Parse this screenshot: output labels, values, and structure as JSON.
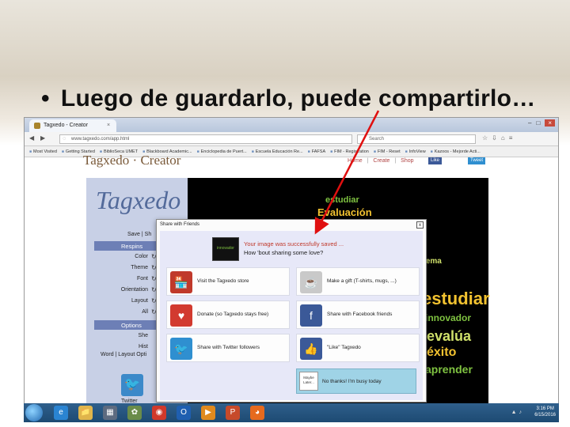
{
  "slide": {
    "bullet": "•",
    "title": "Luego de guardarlo, puede compartirlo…"
  },
  "browser": {
    "tab_title": "Tagxedo - Creator",
    "tab_close": "×",
    "window_controls": [
      "–",
      "□",
      "×"
    ],
    "back": "◀",
    "forward": "▶",
    "url": "www.tagxedo.com/app.html",
    "search_placeholder": "Search",
    "bookmarks": [
      "Most Visited",
      "Getting Started",
      "BiblioSeca UMET",
      "Blackboard Academic...",
      "Enciclopedia de Puert...",
      "Escuela Educación Re...",
      "FAFSA",
      "FIM - Registration",
      "FIM - Reset",
      "InfoView",
      "Kazoos - Mejorde Acti..."
    ]
  },
  "site": {
    "logo": "Tagxedo · Creator",
    "nav": [
      "Home",
      "Create",
      "Shop"
    ],
    "social": [
      {
        "label": "Like",
        "color": "#3b5998"
      },
      {
        "label": "Tweet",
        "color": "#2f8fd0"
      }
    ],
    "panel_logo": "Tagxedo",
    "save_row": "Save | Sh",
    "respins_header": "Respins",
    "respin_items": [
      "Color",
      "Theme",
      "Font",
      "Orientation",
      "Layout",
      "All"
    ],
    "options_header": "Options",
    "option_items": [
      "She",
      "Hist"
    ],
    "word_options": "Word | Layout Opti",
    "twitter_label": "Twitter"
  },
  "word_cloud": {
    "words": [
      "estudiar",
      "Evaluación",
      "innovador",
      "lema",
      "estudiar",
      "innovador",
      "evalúa",
      "éxito",
      "aprender"
    ],
    "colors": [
      "#7fc241",
      "#f2c230",
      "#7fc241",
      "#cfe06a",
      "#f2c230",
      "#7fc241",
      "#cfe06a",
      "#f2c230",
      "#7fc241"
    ]
  },
  "dialog": {
    "title": "Share with Friends",
    "close": "x",
    "thumb_text": "innovador",
    "saved_message": "Your image was successfully saved ...",
    "ask_message": "How 'bout sharing some love?",
    "options": [
      {
        "label": "Visit the Tagxedo store",
        "icon": "store-icon",
        "glyph": "🏪",
        "color": "#c0392b"
      },
      {
        "label": "Make a gift (T-shirts, mugs, ...)",
        "icon": "mug-icon",
        "glyph": "☕",
        "color": "#c9c9c9"
      },
      {
        "label": "Donate (so Tagxedo stays free)",
        "icon": "heart-icon",
        "glyph": "♥",
        "color": "#d23a2f"
      },
      {
        "label": "Share with Facebook friends",
        "icon": "facebook-icon",
        "glyph": "f",
        "color": "#3b5998"
      },
      {
        "label": "Share with Twitter followers",
        "icon": "twitter-icon",
        "glyph": "🐦",
        "color": "#2f8fd0"
      },
      {
        "label": "\"Like\" Tagxedo",
        "icon": "thumbs-up-icon",
        "glyph": "👍",
        "color": "#3b5998"
      }
    ],
    "no_thanks_icon": "Maybe Later...",
    "no_thanks_label": "No thanks! I'm busy today"
  },
  "taskbar": {
    "apps": [
      {
        "name": "ie-icon",
        "glyph": "e",
        "color": "#2a84d2"
      },
      {
        "name": "folder-icon",
        "glyph": "📁",
        "color": "#e0b54b"
      },
      {
        "name": "media-icon",
        "glyph": "▦",
        "color": "#5d6b80"
      },
      {
        "name": "photos-icon",
        "glyph": "✿",
        "color": "#6a8c4a"
      },
      {
        "name": "chrome-icon",
        "glyph": "◉",
        "color": "#d0392b"
      },
      {
        "name": "outlook-icon",
        "glyph": "O",
        "color": "#1f5fb0"
      },
      {
        "name": "player-icon",
        "glyph": "▶",
        "color": "#e08a1e"
      },
      {
        "name": "powerpoint-icon",
        "glyph": "P",
        "color": "#c74a2a"
      },
      {
        "name": "firefox-icon",
        "glyph": "◕",
        "color": "#e66a1e"
      }
    ],
    "time": "3:16 PM",
    "date": "6/15/2016"
  }
}
